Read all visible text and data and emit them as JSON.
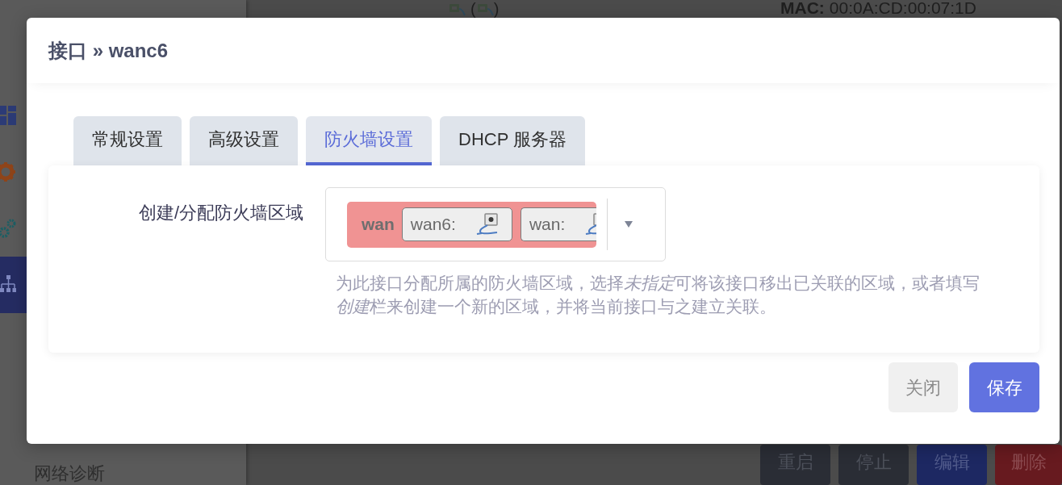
{
  "page": {
    "device_status": {
      "open": "(",
      "close": ")"
    },
    "mac": {
      "label": "MAC:",
      "value": "00:0A:CD:00:07:1D"
    },
    "sidebar": {
      "items": [
        {
          "selected": false
        },
        {
          "selected": false
        },
        {
          "selected": false
        },
        {
          "selected": true
        }
      ],
      "bottom_item": "网络诊断"
    },
    "actions": [
      {
        "label": "重启",
        "kind": "restart"
      },
      {
        "label": "停止",
        "kind": "stop"
      },
      {
        "label": "编辑",
        "kind": "edit"
      },
      {
        "label": "删除",
        "kind": "delete"
      }
    ]
  },
  "dialog": {
    "title": "接口 » wanc6",
    "tabs": [
      {
        "label": "常规设置",
        "selected": false
      },
      {
        "label": "高级设置",
        "selected": false
      },
      {
        "label": "防火墙设置",
        "selected": true
      },
      {
        "label": "DHCP 服务器",
        "selected": false
      }
    ],
    "zone_field": {
      "label": "创建/分配防火墙区域",
      "zone": {
        "name": "wan",
        "color": "#f09393",
        "members": [
          {
            "name": "wan6:"
          },
          {
            "name": "wan:"
          }
        ]
      },
      "help": [
        {
          "text": "为此接口分配所属的防火墙区域，选择",
          "italic": false
        },
        {
          "text": "未指定",
          "italic": true
        },
        {
          "text": "可将该接口移出已关联的区域，或者填写",
          "italic": false
        },
        {
          "text": "创建",
          "italic": true
        },
        {
          "text": "栏来创建一个新的区域，并将当前接口与之建立关联。",
          "italic": false
        }
      ]
    },
    "buttons": [
      {
        "label": "关闭",
        "kind": "close"
      },
      {
        "label": "保存",
        "kind": "save"
      }
    ]
  }
}
